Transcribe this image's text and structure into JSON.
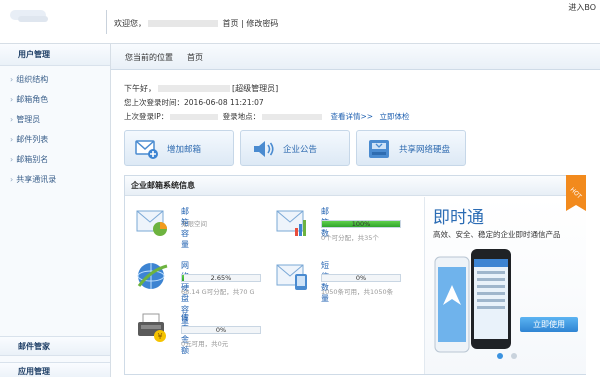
{
  "header": {
    "welcome": "欢迎您，",
    "home_link": "首页",
    "separator": "|",
    "change_password": "修改密码",
    "enter": "进入BO"
  },
  "sidebar": {
    "title": "用户管理",
    "items": [
      {
        "label": "组织结构"
      },
      {
        "label": "邮箱角色"
      },
      {
        "label": "管理员"
      },
      {
        "label": "邮件列表"
      },
      {
        "label": "邮箱别名"
      },
      {
        "label": "共享通讯录"
      }
    ],
    "footer1": "邮件管家",
    "footer2": "应用管理"
  },
  "breadcrumb": {
    "current": "您当前的位置",
    "home": "首页"
  },
  "greeting": {
    "hello": "下午好，",
    "role": "[超级管理员]",
    "last_login_time_label": "您上次登录时间：",
    "last_login_time": "2016-06-08 11:21:07",
    "last_login_ip_label": "上次登录IP：",
    "last_login_place_label": "登录地点：",
    "details_link": "查看详情>>",
    "experience_link": "立即体检"
  },
  "quick_actions": [
    {
      "label": "增加邮箱",
      "icon": "mail-add-icon"
    },
    {
      "label": "企业公告",
      "icon": "speaker-icon"
    },
    {
      "label": "共享网络硬盘",
      "icon": "disk-icon"
    }
  ],
  "panel": {
    "title": "企业邮箱系统信息",
    "metrics": {
      "mail_capacity": {
        "title": "邮箱容量",
        "sub": "无限空间"
      },
      "mail_count": {
        "title": "邮箱数",
        "pct_label": "100%",
        "pct": 100,
        "sub": "0个可分配，共35个"
      },
      "disk_capacity": {
        "title": "网络硬盘容量",
        "pct_label": "2.65%",
        "pct": 2.65,
        "sub": "68.14 G可分配，共70 G"
      },
      "sms_count": {
        "title": "短信数量",
        "pct_label": "0%",
        "pct": 0,
        "sub": "1050条可用，共1050条"
      },
      "fax_amount": {
        "title": "传真金额",
        "pct_label": "0%",
        "pct": 0,
        "sub": "0元可用，共0元"
      }
    }
  },
  "ad": {
    "title": "即时通",
    "subtitle": "高效、安全、稳定的企业即时通信产品",
    "button": "立即使用",
    "badge": "HOT"
  },
  "colors": {
    "accent_blue": "#2b6cb4",
    "progress_green": "#2fa52c"
  }
}
